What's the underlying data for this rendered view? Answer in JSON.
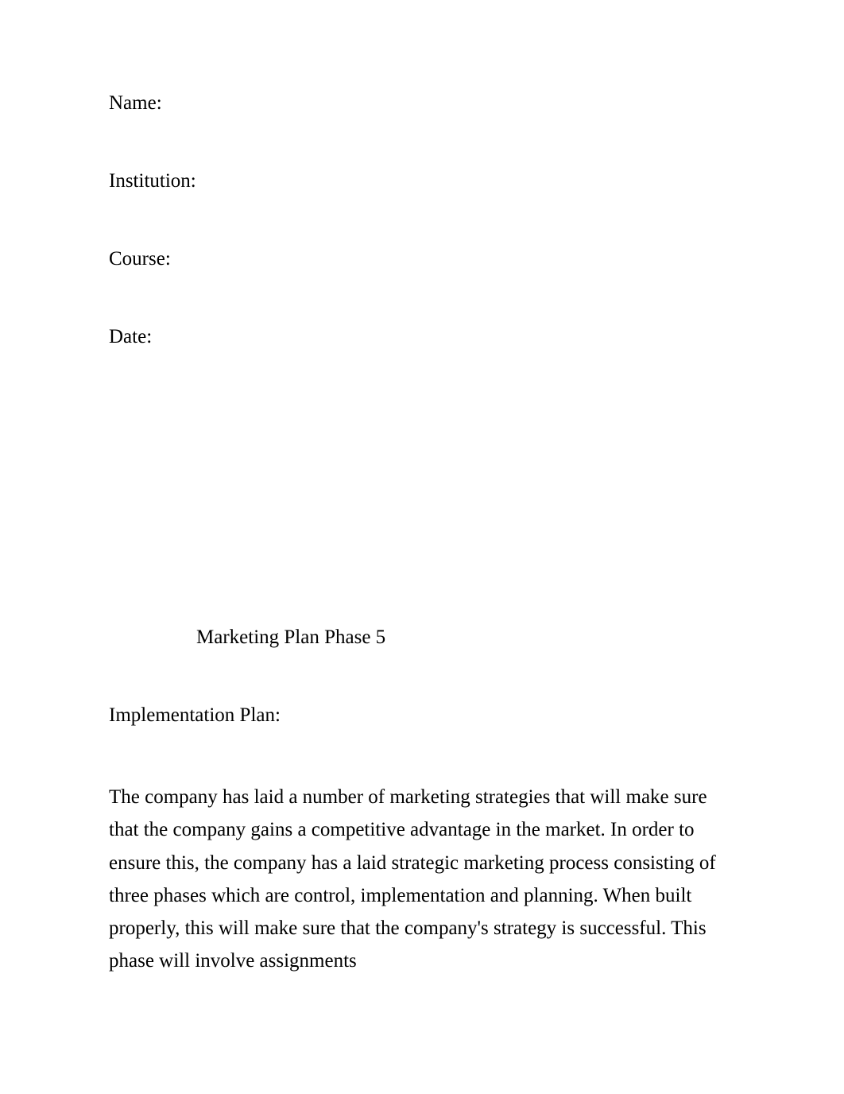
{
  "fields": {
    "name_label": "Name:",
    "institution_label": "Institution:",
    "course_label": "Course:",
    "date_label": "Date:"
  },
  "title": "Marketing Plan Phase 5",
  "subheading": "Implementation Plan:",
  "body_paragraph": "The company has laid a number of marketing strategies that will make sure that the company gains a competitive advantage in the market. In order to ensure this, the company has a laid strategic marketing process consisting of three phases which are control, implementation and planning. When built properly, this will make sure that the company's strategy is successful. This phase will involve assignments"
}
